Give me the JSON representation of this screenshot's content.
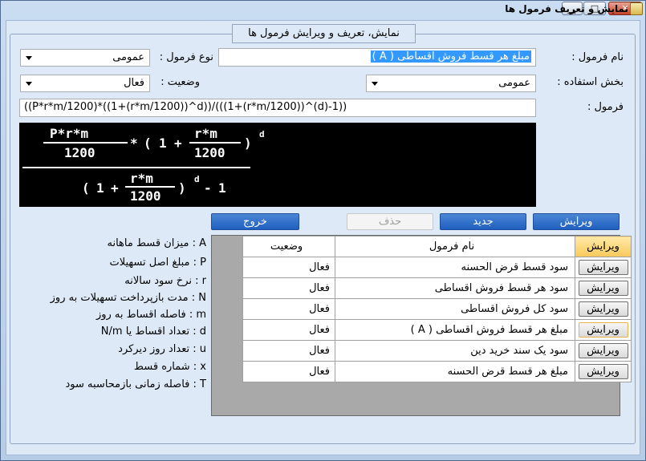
{
  "window": {
    "title": "نمایش و تعریف فرمول ها",
    "minimize": "▁",
    "maximize": "□",
    "close": "✕"
  },
  "group": {
    "title": "نمایش، تعریف و ویرایش فرمول ها"
  },
  "form": {
    "name_label": "نام فرمول :",
    "name_value": "مبلغ هر قسط فروش اقساطی ( A )",
    "type_label": "نوع فرمول :",
    "type_value": "عمومی",
    "usage_label": "بخش استفاده :",
    "usage_value": "عمومی",
    "status_label": "وضعیت :",
    "status_value": "فعال",
    "formula_label": "فرمول :",
    "formula_value": "((P*r*m/1200)*((1+(r*m/1200))^d))/(((1+(r*m/1200))^(d)-1))"
  },
  "formula_render": {
    "num_top": "P*r*m",
    "den_1200": "1200",
    "times": "*",
    "open": "(",
    "one": "1",
    "plus": "+",
    "frac_top": "r*m",
    "close": ")",
    "exp": "d",
    "minus": "-",
    "one_b": "1"
  },
  "buttons": {
    "edit": "ویرایش",
    "new": "جدید",
    "delete": "حذف",
    "exit": "خروج"
  },
  "table": {
    "headers": {
      "edit": "ویرایش",
      "name": "نام فرمول",
      "status": "وضعیت"
    },
    "rows": [
      {
        "edit": "ویرایش",
        "name": "سود قسط قرض الحسنه",
        "status": "فعال"
      },
      {
        "edit": "ویرایش",
        "name": "سود هر قسط فروش اقساطی",
        "status": "فعال"
      },
      {
        "edit": "ویرایش",
        "name": "سود کل فروش اقساطی",
        "status": "فعال"
      },
      {
        "edit": "ویرایش",
        "name": "مبلغ هر قسط فروش اقساطی ( A )",
        "status": "فعال"
      },
      {
        "edit": "ویرایش",
        "name": "سود یک سند خرید دین",
        "status": "فعال"
      },
      {
        "edit": "ویرایش",
        "name": "مبلغ هر قسط قرض الحسنه",
        "status": "فعال"
      }
    ]
  },
  "legend": [
    "A : میزان قسط ماهانه",
    "P : مبلغ اصل تسهیلات",
    "r : نرخ سود سالانه",
    "N : مدت بازپرداخت تسهیلات به روز",
    "m : فاصله اقساط به روز",
    "d : تعداد اقساط یا N/m",
    "u : تعداد روز دیرکرد",
    "x : شماره قسط",
    "T : فاصله زمانی بازمحاسبه سود"
  ]
}
